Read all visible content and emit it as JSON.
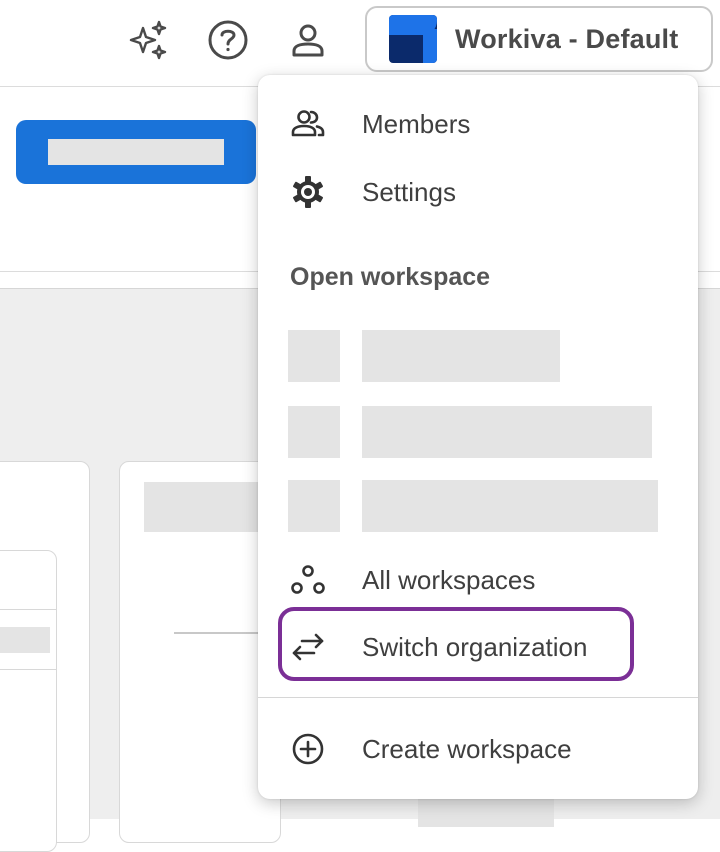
{
  "header": {
    "icons": [
      "sparkle-icon",
      "help-icon",
      "user-icon"
    ],
    "org_switcher": {
      "label": "Workiva - Default",
      "logo": "workiva-logo"
    }
  },
  "menu": {
    "items_top": [
      {
        "label": "Members",
        "icon": "members-icon"
      },
      {
        "label": "Settings",
        "icon": "gear-icon"
      }
    ],
    "open_workspace_label": "Open workspace",
    "items_bottom": [
      {
        "label": "All workspaces",
        "icon": "workspaces-icon"
      },
      {
        "label": "Switch organization",
        "icon": "switch-arrows-icon"
      }
    ],
    "create": {
      "label": "Create workspace",
      "icon": "plus-circle-icon"
    }
  },
  "colors": {
    "primary": "#1a73d9",
    "highlight": "#7b2f96",
    "logo_dark": "#0b2a6b",
    "logo_light": "#1e73e8"
  }
}
